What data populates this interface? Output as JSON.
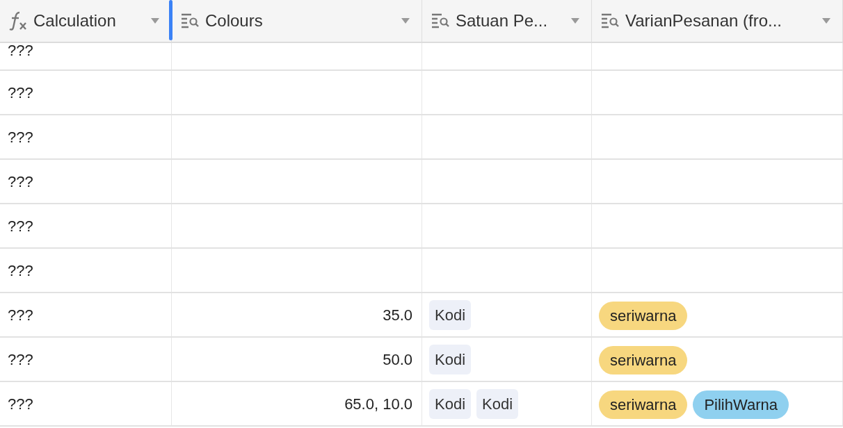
{
  "columns": [
    {
      "kind": "formula",
      "label": "Calculation",
      "resizing": false
    },
    {
      "kind": "lookup",
      "label": "Colours",
      "resizing": true
    },
    {
      "kind": "lookup",
      "label": "Satuan Pe..."
    },
    {
      "kind": "lookup",
      "label": "VarianPesanan (fro..."
    }
  ],
  "rows": [
    {
      "calculation": "???",
      "colours": "",
      "satuan": [],
      "varian": []
    },
    {
      "calculation": "???",
      "colours": "",
      "satuan": [],
      "varian": []
    },
    {
      "calculation": "???",
      "colours": "",
      "satuan": [],
      "varian": []
    },
    {
      "calculation": "???",
      "colours": "",
      "satuan": [],
      "varian": []
    },
    {
      "calculation": "???",
      "colours": "",
      "satuan": [],
      "varian": []
    },
    {
      "calculation": "???",
      "colours": "",
      "satuan": [],
      "varian": []
    },
    {
      "calculation": "???",
      "colours": "35.0",
      "satuan": [
        "Kodi"
      ],
      "varian": [
        {
          "label": "seriwarna",
          "color": "#f7d77f"
        }
      ]
    },
    {
      "calculation": "???",
      "colours": "50.0",
      "satuan": [
        "Kodi"
      ],
      "varian": [
        {
          "label": "seriwarna",
          "color": "#f7d77f"
        }
      ]
    },
    {
      "calculation": "???",
      "colours": "65.0, 10.0",
      "satuan": [
        "Kodi",
        "Kodi"
      ],
      "varian": [
        {
          "label": "seriwarna",
          "color": "#f7d77f"
        },
        {
          "label": "PilihWarna",
          "color": "#8fd0ef"
        }
      ]
    }
  ]
}
